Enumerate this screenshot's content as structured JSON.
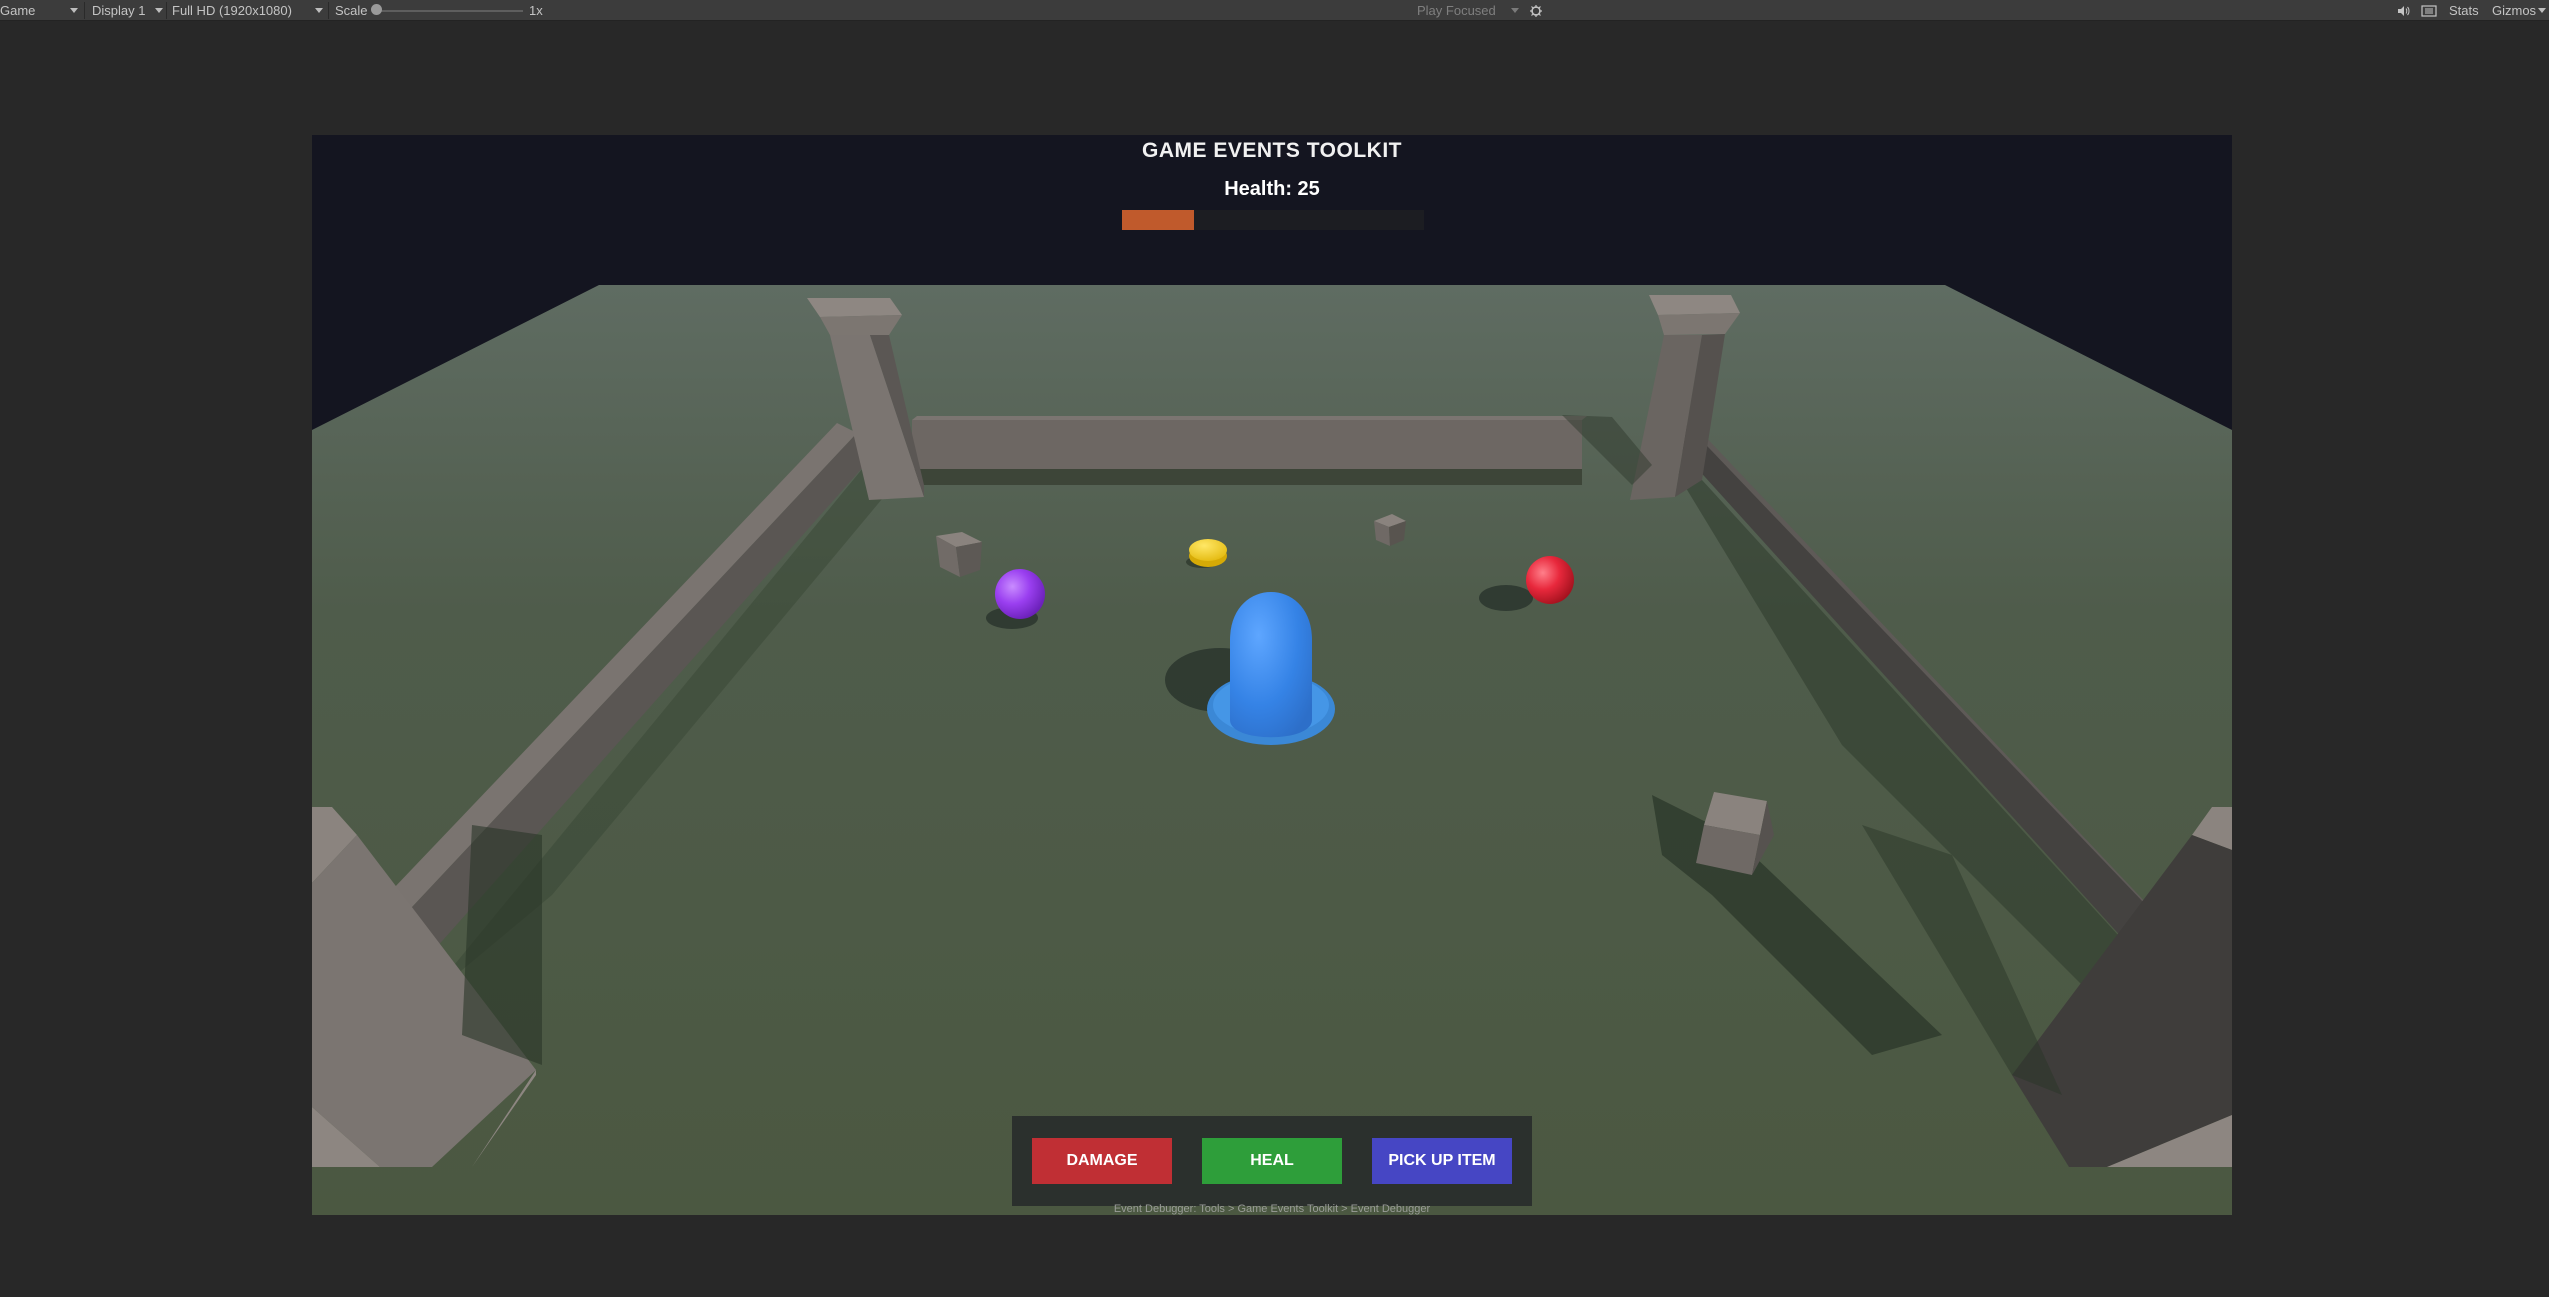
{
  "toolbar": {
    "view_label": "Game",
    "display_label": "Display 1",
    "resolution_label": "Full HD (1920x1080)",
    "scale_label": "Scale",
    "scale_value": "1x",
    "play_mode_label": "Play Focused",
    "stats_label": "Stats",
    "gizmos_label": "Gizmos",
    "icons": [
      "dropdown-caret-icon",
      "debug-bug-icon",
      "audio-mute-icon",
      "layout-icon"
    ]
  },
  "hud": {
    "title": "GAME EVENTS TOOLKIT",
    "health_label": "Health: 25",
    "health_fraction": 0.24,
    "health_color": "#c05a2c",
    "hint": "Event Debugger: Tools > Game Events Toolkit > Event Debugger"
  },
  "buttons": {
    "damage": "DAMAGE",
    "heal": "HEAL",
    "pickup": "PICK UP ITEM",
    "damage_color": "#c02f34",
    "heal_color": "#2e9e3a",
    "pickup_color": "#4646c4"
  },
  "scene": {
    "background_color": "#141520",
    "floor_color": "#4e5c45",
    "wall_color": "#6f6a66",
    "player_color": "#3a86e6",
    "objects": [
      "player-capsule",
      "purple-orb",
      "red-orb",
      "yellow-coin",
      "stone-cube"
    ]
  }
}
